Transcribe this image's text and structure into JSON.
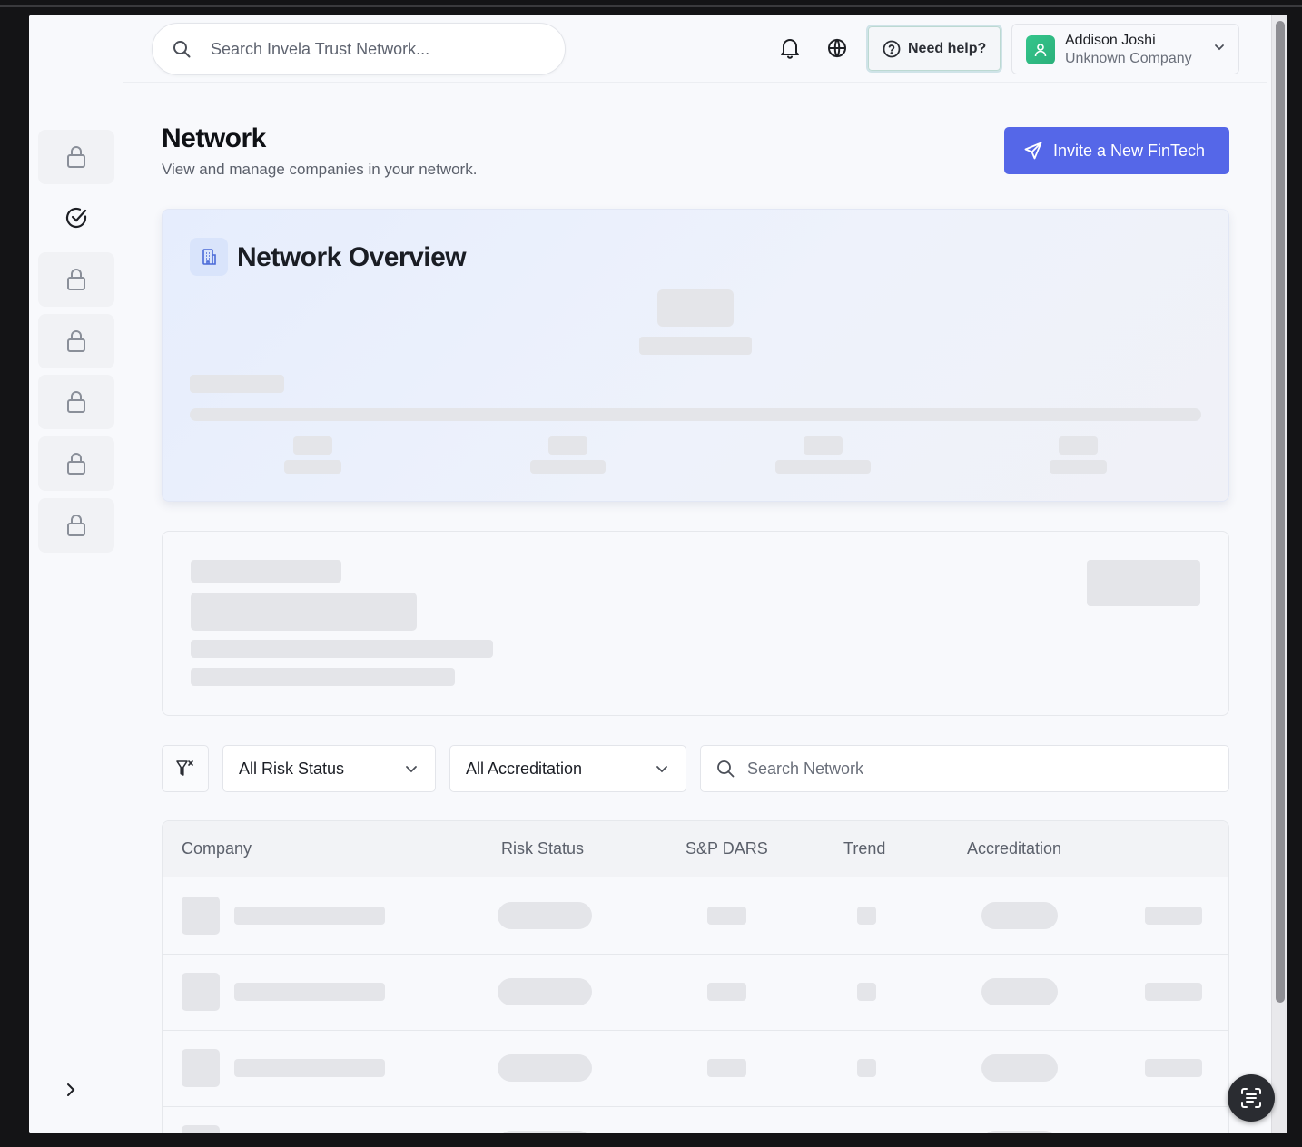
{
  "topbar": {
    "search_placeholder": "Search Invela Trust Network...",
    "help_label": "Need help?",
    "user": {
      "name": "Addison Joshi",
      "company": "Unknown Company"
    }
  },
  "sidebar": {
    "items": [
      {
        "name": "locked",
        "icon": "lock-icon"
      },
      {
        "name": "tasks",
        "icon": "check-circle-icon"
      },
      {
        "name": "locked",
        "icon": "lock-icon"
      },
      {
        "name": "locked",
        "icon": "lock-icon"
      },
      {
        "name": "locked",
        "icon": "lock-icon"
      },
      {
        "name": "locked",
        "icon": "lock-icon"
      },
      {
        "name": "locked",
        "icon": "lock-icon"
      }
    ]
  },
  "page": {
    "title": "Network",
    "subtitle": "View and manage companies in your network.",
    "invite_label": "Invite a New FinTech"
  },
  "overview": {
    "title": "Network Overview"
  },
  "filters": {
    "risk_status": "All Risk Status",
    "accreditation": "All Accreditation",
    "search_placeholder": "Search Network"
  },
  "table": {
    "columns": [
      "Company",
      "Risk Status",
      "S&P DARS",
      "Trend",
      "Accreditation"
    ]
  },
  "colors": {
    "accent": "#5567e8",
    "avatar": "#34c58c"
  }
}
